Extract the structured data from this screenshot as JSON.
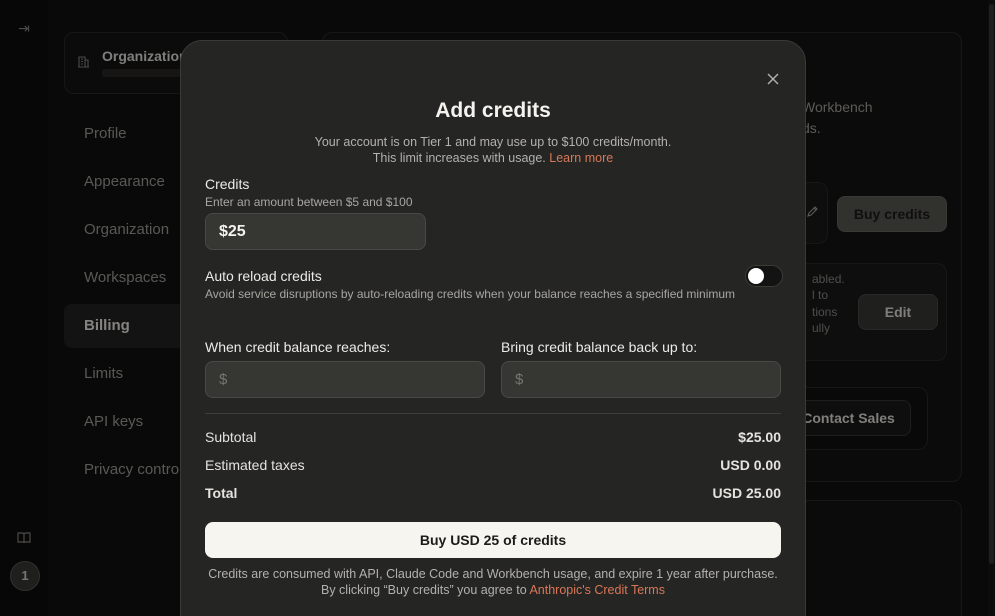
{
  "rail": {
    "collapse_icon": "sidebar-collapse-icon",
    "docs_icon": "book-icon",
    "avatar_initial": "1"
  },
  "org_card": {
    "name": "Organization",
    "icon": "building-icon"
  },
  "nav": [
    {
      "label": "Profile"
    },
    {
      "label": "Appearance"
    },
    {
      "label": "Organization"
    },
    {
      "label": "Workspaces"
    },
    {
      "label": "Billing"
    },
    {
      "label": "Limits"
    },
    {
      "label": "API keys"
    },
    {
      "label": "Privacy controls"
    }
  ],
  "billing_bg": {
    "partial_line1": "Workbench",
    "partial_line2": "ds.",
    "buy_credits_label": "Buy credits",
    "edit_icon": "pencil-icon",
    "autoreload_partial": [
      "abled.",
      "l to",
      "tions",
      "ully"
    ],
    "edit_label": "Edit",
    "contact_sales_label": "Contact Sales"
  },
  "modal": {
    "title": "Add credits",
    "intro_line1": "Your account is on Tier 1 and may use up to $100 credits/month.",
    "intro_line2": "This limit increases with usage.",
    "learn_more": "Learn more",
    "credits_label": "Credits",
    "credits_hint": "Enter an amount between $5 and $100",
    "credits_value": "$25",
    "auto_reload_label": "Auto reload credits",
    "auto_reload_hint": "Avoid service disruptions by auto-reloading credits when your balance reaches a specified minimum",
    "auto_reload_enabled": false,
    "threshold_label": "When credit balance reaches:",
    "threshold_prefix": "$",
    "threshold_value": "",
    "refill_label": "Bring credit balance back up to:",
    "refill_prefix": "$",
    "refill_value": "",
    "subtotal_label": "Subtotal",
    "subtotal_value": "$25.00",
    "taxes_label": "Estimated taxes",
    "taxes_value": "USD 0.00",
    "total_label": "Total",
    "total_value": "USD 25.00",
    "buy_button": "Buy USD 25 of credits",
    "footer_text": "Credits are consumed with API, Claude Code and Workbench usage, and expire 1 year after purchase. By clicking “Buy credits” you agree to",
    "footer_link": "Anthropic's Credit Terms",
    "close_icon": "close-icon"
  }
}
